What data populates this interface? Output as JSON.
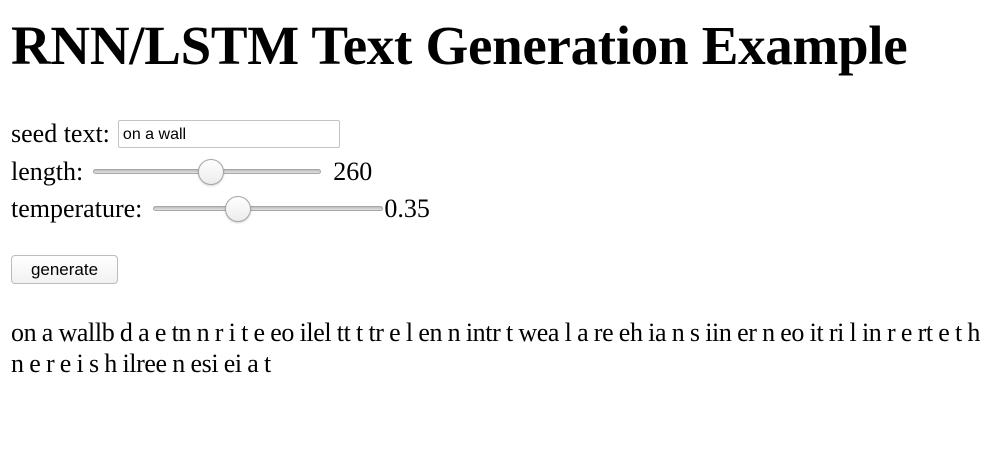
{
  "page": {
    "title": "RNN/LSTM Text Generation Example"
  },
  "form": {
    "seed": {
      "label": "seed text:",
      "value": "on a wall"
    },
    "length": {
      "label": "length:",
      "value": "260",
      "fraction": 0.52
    },
    "temperature": {
      "label": "temperature:",
      "value": "0.35",
      "fraction": 0.35
    },
    "generate_label": "generate"
  },
  "output": {
    "text": "on a wallb d a e tn n r i t e eo ilel tt t tr e l en n intr t wea l a re eh ia n s iin er n eo it ri l in r e rt e t h n e r e i s h ilree n esi ei a t"
  },
  "colors": {
    "background": "#ffffff",
    "text": "#000000",
    "input_border": "#c3c3c3"
  }
}
